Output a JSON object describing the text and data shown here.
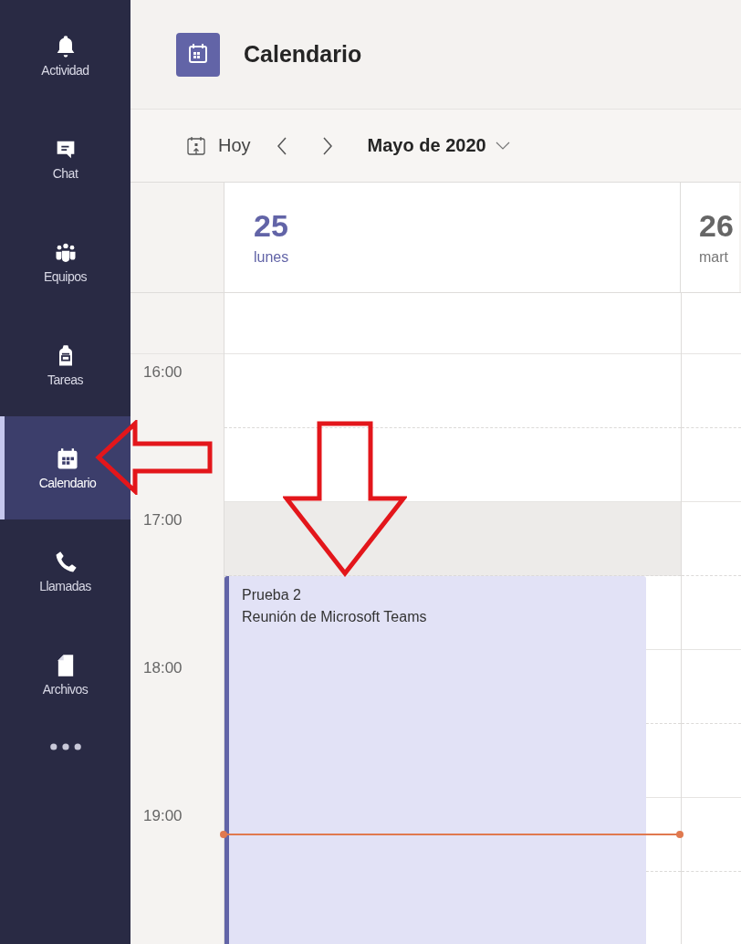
{
  "sidebar": {
    "items": [
      {
        "label": "Actividad",
        "selected": false
      },
      {
        "label": "Chat",
        "selected": false
      },
      {
        "label": "Equipos",
        "selected": false
      },
      {
        "label": "Tareas",
        "selected": false
      },
      {
        "label": "Calendario",
        "selected": true
      },
      {
        "label": "Llamadas",
        "selected": false
      },
      {
        "label": "Archivos",
        "selected": false
      }
    ]
  },
  "header": {
    "title": "Calendario"
  },
  "toolbar": {
    "today": "Hoy",
    "month": "Mayo de 2020"
  },
  "days": [
    {
      "number": "25",
      "weekday": "lunes",
      "selected": true
    },
    {
      "number": "26",
      "weekday": "mart",
      "selected": false
    }
  ],
  "hours": [
    {
      "label": "16:00"
    },
    {
      "label": "17:00",
      "shaded": true
    },
    {
      "label": "18:00"
    },
    {
      "label": "19:00"
    }
  ],
  "event": {
    "title": "Prueba 2",
    "subtitle": "Reunión de Microsoft Teams"
  }
}
